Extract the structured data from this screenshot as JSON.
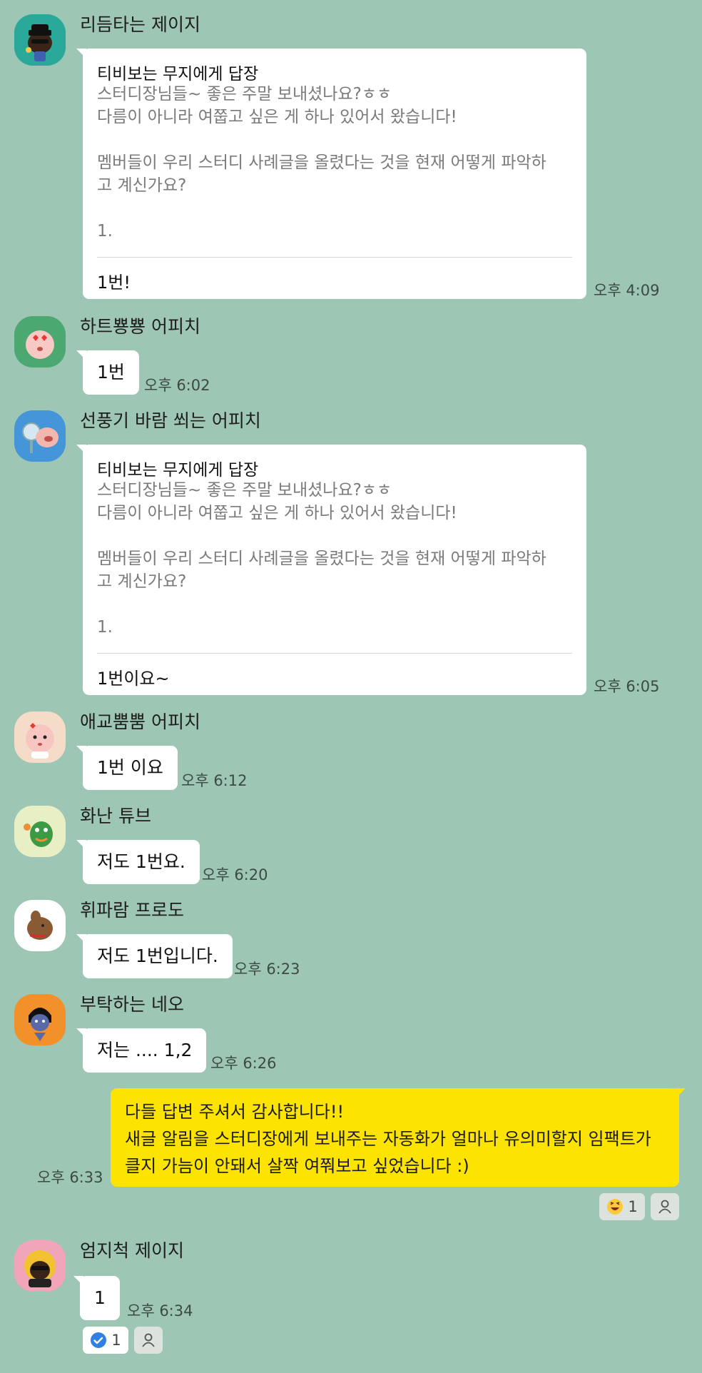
{
  "messages": [
    {
      "sender": "리듬타는 제이지",
      "reply_to": "티비보는 무지에게 답장",
      "quote_lines": [
        "스터디장님들~ 좋은 주말 보내셨나요?ㅎㅎ",
        "다름이 아니라 여쭙고 싶은 게 하나 있어서 왔습니다!",
        "",
        "멤버들이 우리 스터디 사례글을 올렸다는 것을 현재 어떻게 파악하",
        "고 계신가요?",
        "",
        "1."
      ],
      "text": "1번!",
      "time": "오후 4:09"
    },
    {
      "sender": "하트뿅뿅 어피치",
      "text": "1번",
      "time": "오후 6:02"
    },
    {
      "sender": "선풍기 바람 쐬는 어피치",
      "reply_to": "티비보는 무지에게 답장",
      "quote_lines": [
        "스터디장님들~ 좋은 주말 보내셨나요?ㅎㅎ",
        "다름이 아니라 여쭙고 싶은 게 하나 있어서 왔습니다!",
        "",
        "멤버들이 우리 스터디 사례글을 올렸다는 것을 현재 어떻게 파악하",
        "고 계신가요?",
        "",
        "1."
      ],
      "text": "1번이요~",
      "time": "오후 6:05"
    },
    {
      "sender": "애교뿜뿜 어피치",
      "text": "1번 이요",
      "time": "오후 6:12"
    },
    {
      "sender": "화난 튜브",
      "text": "저도 1번요.",
      "time": "오후 6:20"
    },
    {
      "sender": "휘파람 프로도",
      "text": "저도 1번입니다.",
      "time": "오후 6:23"
    },
    {
      "sender": "부탁하는 네오",
      "text": "저는 .... 1,2",
      "time": "오후 6:26"
    },
    {
      "sender": "me",
      "lines": [
        "다들 답변 주셔서 감사합니다!!",
        "새글 알림을 스터디장에게 보내주는 자동화가 얼마나 유의미할지 임팩트가",
        "클지 가늠이 안돼서 살짝 여쭤보고 싶었습니다 :)"
      ],
      "time": "오후 6:33",
      "reaction_count": "1"
    },
    {
      "sender": "엄지척 제이지",
      "text": "1",
      "time": "오후 6:34",
      "reaction_count": "1"
    }
  ],
  "colors": {
    "background": "#9ec6b4",
    "my_bubble": "#fde400",
    "other_bubble": "#ffffff",
    "check": "#2f80e0"
  },
  "icons": [
    "laughing-emoji-icon",
    "person-icon",
    "check-circle-icon"
  ]
}
